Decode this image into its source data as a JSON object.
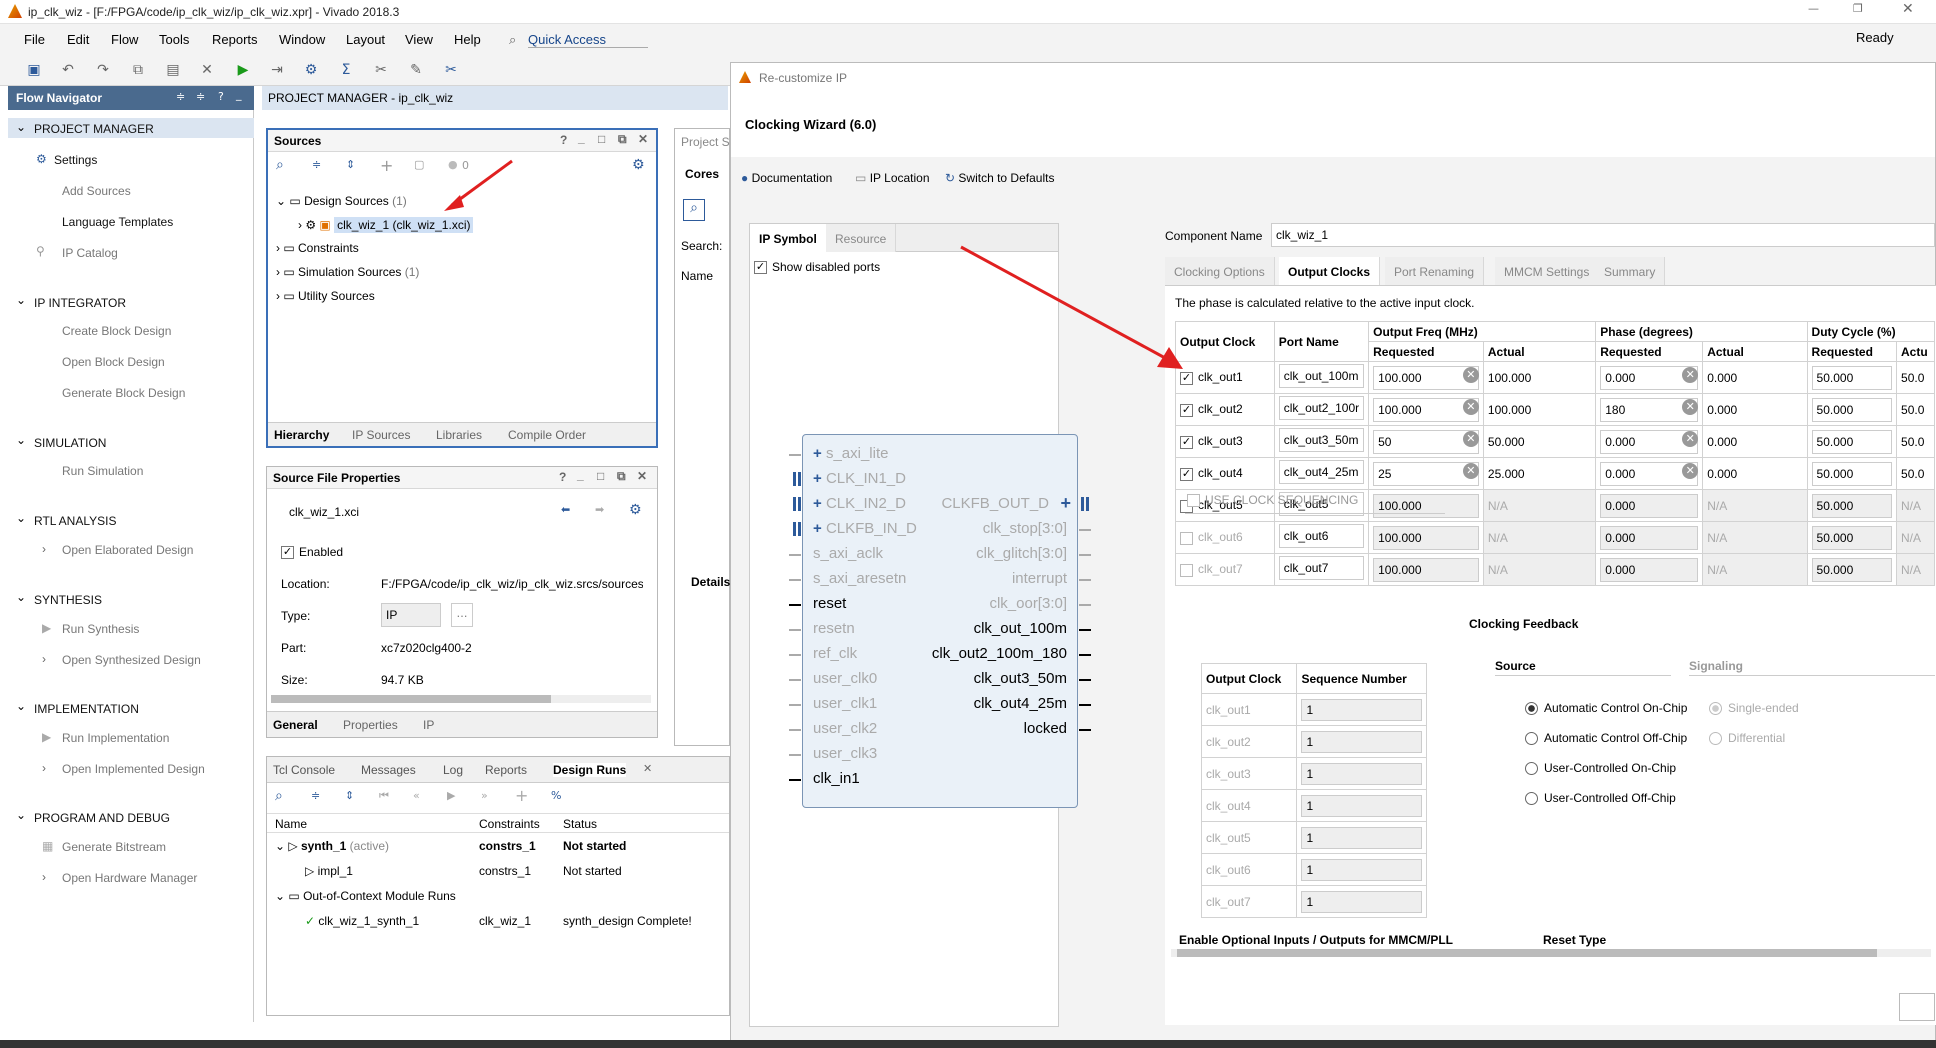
{
  "window": {
    "title": "ip_clk_wiz - [F:/FPGA/code/ip_clk_wiz/ip_clk_wiz.xpr] - Vivado 2018.3",
    "status": "Ready"
  },
  "menu": [
    "File",
    "Edit",
    "Flow",
    "Tools",
    "Reports",
    "Window",
    "Layout",
    "View",
    "Help"
  ],
  "quick_access": "Quick Access",
  "flow_nav": {
    "title": "Flow Navigator",
    "sections": [
      {
        "title": "PROJECT MANAGER",
        "items": [
          "Settings",
          "Add Sources",
          "Language Templates",
          "IP Catalog"
        ]
      },
      {
        "title": "IP INTEGRATOR",
        "items": [
          "Create Block Design",
          "Open Block Design",
          "Generate Block Design"
        ]
      },
      {
        "title": "SIMULATION",
        "items": [
          "Run Simulation"
        ]
      },
      {
        "title": "RTL ANALYSIS",
        "items": [
          "Open Elaborated Design"
        ]
      },
      {
        "title": "SYNTHESIS",
        "items": [
          "Run Synthesis",
          "Open Synthesized Design"
        ]
      },
      {
        "title": "IMPLEMENTATION",
        "items": [
          "Run Implementation",
          "Open Implemented Design"
        ]
      },
      {
        "title": "PROGRAM AND DEBUG",
        "items": [
          "Generate Bitstream",
          "Open Hardware Manager"
        ]
      }
    ]
  },
  "pm_title": "PROJECT MANAGER - ip_clk_wiz",
  "sources": {
    "title": "Sources",
    "count": "0",
    "tree": [
      {
        "label": "Design Sources",
        "count": "(1)"
      },
      {
        "label": "clk_wiz_1 (clk_wiz_1.xci)",
        "count": ""
      },
      {
        "label": "Constraints",
        "count": ""
      },
      {
        "label": "Simulation Sources",
        "count": "(1)"
      },
      {
        "label": "Utility Sources",
        "count": ""
      }
    ],
    "tabs": [
      "Hierarchy",
      "IP Sources",
      "Libraries",
      "Compile Order"
    ]
  },
  "sfp": {
    "title": "Source File Properties",
    "file": "clk_wiz_1.xci",
    "enabled": "Enabled",
    "rows": [
      {
        "k": "Location:",
        "v": "F:/FPGA/code/ip_clk_wiz/ip_clk_wiz.srcs/sources"
      },
      {
        "k": "Type:",
        "v": "IP"
      },
      {
        "k": "Part:",
        "v": "xc7z020clg400-2"
      },
      {
        "k": "Size:",
        "v": "94.7 KB"
      }
    ],
    "tabs": [
      "General",
      "Properties",
      "IP"
    ]
  },
  "bottom": {
    "tabs": [
      "Tcl Console",
      "Messages",
      "Log",
      "Reports",
      "Design Runs"
    ],
    "cols": [
      "Name",
      "Constraints",
      "Status"
    ],
    "rows": [
      {
        "name": "synth_1",
        "extra": "(active)",
        "c": "constrs_1",
        "s": "Not started"
      },
      {
        "name": "impl_1",
        "extra": "",
        "c": "constrs_1",
        "s": "Not started"
      },
      {
        "name": "Out-of-Context Module Runs",
        "extra": "",
        "c": "",
        "s": ""
      },
      {
        "name": "clk_wiz_1_synth_1",
        "extra": "",
        "c": "clk_wiz_1",
        "s": "synth_design Complete!"
      }
    ]
  },
  "mid": {
    "project": "Project S",
    "cores": "Cores",
    "search": "Search:",
    "name": "Name",
    "details": "Details"
  },
  "dialog": {
    "title": "Re-customize IP",
    "heading": "Clocking Wizard (6.0)",
    "links": [
      "Documentation",
      "IP Location",
      "Switch to Defaults"
    ],
    "left_tabs": [
      "IP Symbol",
      "Resource"
    ],
    "show_disabled": "Show disabled ports",
    "component_label": "Component Name",
    "component_name": "clk_wiz_1",
    "tabs": [
      "Clocking Options",
      "Output Clocks",
      "Port Renaming",
      "MMCM Settings",
      "Summary"
    ],
    "note": "The phase is calculated relative to the active input clock.",
    "hdr": {
      "oc": "Output Clock",
      "pn": "Port Name",
      "of": "Output Freq (MHz)",
      "ph": "Phase (degrees)",
      "dc": "Duty Cycle (%)",
      "req": "Requested",
      "act": "Actual",
      "actu": "Actu"
    },
    "clocks": [
      {
        "n": "clk_out1",
        "p": "clk_out_100m",
        "f": "100.000",
        "fa": "100.000",
        "ph": "0.000",
        "pa": "0.000",
        "d": "50.000",
        "da": "50.0",
        "on": true
      },
      {
        "n": "clk_out2",
        "p": "clk_out2_100r",
        "f": "100.000",
        "fa": "100.000",
        "ph": "180",
        "pa": "0.000",
        "d": "50.000",
        "da": "50.0",
        "on": true
      },
      {
        "n": "clk_out3",
        "p": "clk_out3_50m",
        "f": "50",
        "fa": "50.000",
        "ph": "0.000",
        "pa": "0.000",
        "d": "50.000",
        "da": "50.0",
        "on": true
      },
      {
        "n": "clk_out4",
        "p": "clk_out4_25m",
        "f": "25",
        "fa": "25.000",
        "ph": "0.000",
        "pa": "0.000",
        "d": "50.000",
        "da": "50.0",
        "on": true
      },
      {
        "n": "clk_out5",
        "p": "clk_out5",
        "f": "100.000",
        "fa": "N/A",
        "ph": "0.000",
        "pa": "N/A",
        "d": "50.000",
        "da": "N/A",
        "on": false
      },
      {
        "n": "clk_out6",
        "p": "clk_out6",
        "f": "100.000",
        "fa": "N/A",
        "ph": "0.000",
        "pa": "N/A",
        "d": "50.000",
        "da": "N/A",
        "on": false
      },
      {
        "n": "clk_out7",
        "p": "clk_out7",
        "f": "100.000",
        "fa": "N/A",
        "ph": "0.000",
        "pa": "N/A",
        "d": "50.000",
        "da": "N/A",
        "on": false
      }
    ],
    "use_seq": "USE CLOCK SEQUENCING",
    "seq_hdr": [
      "Output Clock",
      "Sequence Number"
    ],
    "seq": [
      {
        "c": "clk_out1",
        "n": "1"
      },
      {
        "c": "clk_out2",
        "n": "1"
      },
      {
        "c": "clk_out3",
        "n": "1"
      },
      {
        "c": "clk_out4",
        "n": "1"
      },
      {
        "c": "clk_out5",
        "n": "1"
      },
      {
        "c": "clk_out6",
        "n": "1"
      },
      {
        "c": "clk_out7",
        "n": "1"
      }
    ],
    "fb": {
      "title": "Clocking Feedback",
      "source": "Source",
      "signaling": "Signaling",
      "src": [
        "Automatic Control On-Chip",
        "Automatic Control Off-Chip",
        "User-Controlled On-Chip",
        "User-Controlled Off-Chip"
      ],
      "sig": [
        "Single-ended",
        "Differential"
      ]
    },
    "enable_opt": "Enable Optional Inputs / Outputs for MMCM/PLL",
    "reset_type": "Reset Type",
    "sym_left": [
      "s_axi_lite",
      "CLK_IN1_D",
      "CLK_IN2_D",
      "CLKFB_IN_D",
      "s_axi_aclk",
      "s_axi_aresetn",
      "reset",
      "resetn",
      "ref_clk",
      "user_clk0",
      "user_clk1",
      "user_clk2",
      "user_clk3",
      "clk_in1"
    ],
    "sym_right": [
      "CLKFB_OUT_D",
      "clk_stop[3:0]",
      "clk_glitch[3:0]",
      "interrupt",
      "clk_oor[3:0]",
      "clk_out_100m",
      "clk_out2_100m_180",
      "clk_out3_50m",
      "clk_out4_25m",
      "locked"
    ]
  }
}
